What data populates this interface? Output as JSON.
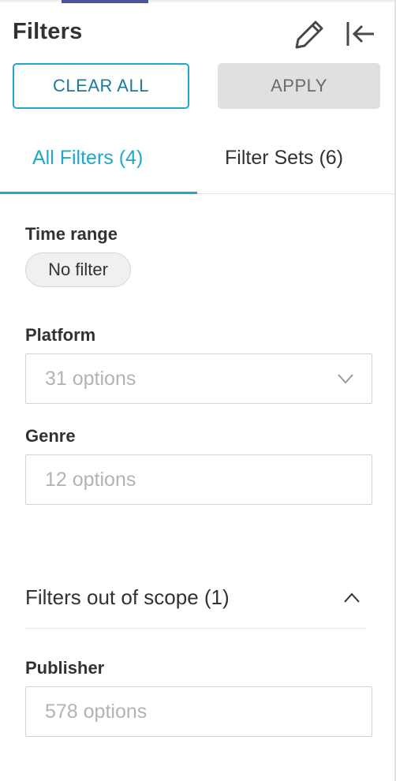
{
  "header": {
    "title": "Filters",
    "edit_icon": "pencil-icon",
    "collapse_icon": "collapse-left-icon"
  },
  "actions": {
    "clear_all": "CLEAR ALL",
    "apply": "APPLY"
  },
  "tabs": [
    {
      "label": "All Filters (4)",
      "active": true
    },
    {
      "label": "Filter Sets (6)",
      "active": false
    }
  ],
  "filters": {
    "time_range": {
      "label": "Time range",
      "value": "No filter"
    },
    "platform": {
      "label": "Platform",
      "placeholder": "31 options"
    },
    "genre": {
      "label": "Genre",
      "placeholder": "12 options"
    }
  },
  "out_of_scope": {
    "title": "Filters out of scope (1)",
    "expanded": true,
    "publisher": {
      "label": "Publisher",
      "placeholder": "578 options"
    }
  },
  "colors": {
    "accent": "#20a7c9",
    "text": "#323232",
    "placeholder": "#b3b3b3",
    "apply_bg": "#e0e0e0"
  }
}
